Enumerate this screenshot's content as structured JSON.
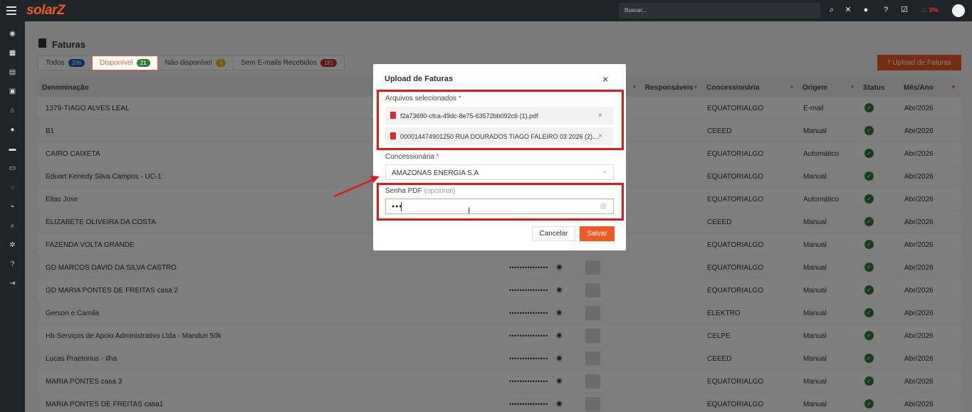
{
  "app": {
    "logo": "solarZ",
    "search_placeholder": "Buscar...",
    "pct": "0%"
  },
  "page": {
    "title": "Faturas"
  },
  "tabs": [
    {
      "label": "Todos",
      "count": "206",
      "color": "#1e5bb8"
    },
    {
      "label": "Disponível",
      "count": "21",
      "color": "#2e7d32"
    },
    {
      "label": "Não disponível",
      "count": "4",
      "color": "#f0b400"
    },
    {
      "label": "Sem E-mails Recebidos",
      "count": "181",
      "color": "#c62828"
    }
  ],
  "upload_button": "⤒  Upload de Faturas",
  "table": {
    "headers": {
      "denominacao": "Denominação",
      "responsaveis": "Responsáveis",
      "concessionaria": "Concessionária",
      "origem": "Origem",
      "status": "Status",
      "mes_ano": "Mês/Ano"
    },
    "rows": [
      {
        "name": "1379-TIAGO ALVES LEAL",
        "conc": "EQUATORIALGO",
        "origem": "E-mail",
        "mes": "Abr/2026",
        "pw": false
      },
      {
        "name": "B1",
        "conc": "CEEED",
        "origem": "Manual",
        "mes": "Abr/2026",
        "pw": false
      },
      {
        "name": "CAIRO CAIXETA",
        "conc": "EQUATORIALGO",
        "origem": "Automático",
        "mes": "Abr/2026",
        "pw": false
      },
      {
        "name": "Eduart Kenedy Silva Campos - UC-1",
        "conc": "EQUATORIALGO",
        "origem": "Manual",
        "mes": "Abr/2026",
        "pw": false
      },
      {
        "name": "Elias Jose",
        "conc": "EQUATORIALGO",
        "origem": "Automático",
        "mes": "Abr/2026",
        "pw": false
      },
      {
        "name": "ELIZABETE OLIVEIRA DA COSTA",
        "conc": "CEEED",
        "origem": "Manual",
        "mes": "Abr/2026",
        "pw": false
      },
      {
        "name": "FAZENDA VOLTA GRANDE",
        "conc": "EQUATORIALGO",
        "origem": "Manual",
        "mes": "Abr/2026",
        "pw": false
      },
      {
        "name": "GD MARCOS DAVID DA SILVA CASTRO",
        "conc": "EQUATORIALGO",
        "origem": "Manual",
        "mes": "Abr/2026",
        "pw": true
      },
      {
        "name": "GD MARIA PONTES DE FREITAS casa 2",
        "conc": "EQUATORIALGO",
        "origem": "Manual",
        "mes": "Abr/2026",
        "pw": true
      },
      {
        "name": "Gerson e Camila",
        "conc": "ELEKTRO",
        "origem": "Manual",
        "mes": "Abr/2026",
        "pw": true
      },
      {
        "name": "Hb Serviços de Apoio Administrativo Ltda - Manduri 50k",
        "conc": "CELPE",
        "origem": "Manual",
        "mes": "Abr/2026",
        "pw": true
      },
      {
        "name": "Lucas Praetorius - Ilha",
        "conc": "CEEED",
        "origem": "Manual",
        "mes": "Abr/2026",
        "pw": true
      },
      {
        "name": "MARIA PONTES casa 3",
        "conc": "EQUATORIALGO",
        "origem": "Manual",
        "mes": "Abr/2026",
        "pw": true
      },
      {
        "name": "MARIA PONTES DE FREITAS casa1",
        "conc": "EQUATORIALGO",
        "origem": "Manual",
        "mes": "Abr/2026",
        "pw": true
      }
    ],
    "password_mask": "•••••••••••••••"
  },
  "modal": {
    "title": "Upload de Faturas",
    "close": "×",
    "files_label": "Arquivos selecionados",
    "required_mark": "*",
    "files": [
      "f2a73690-cfca-49dc-8e75-63572bb092c6 (1).pdf",
      "000014474901250 RUA DOURADOS TIAGO FALEIRO 03 2026 (2)...."
    ],
    "remove": "×",
    "conc_label": "Concessionária",
    "conc_value": "AMAZONAS ENERGIA S.A",
    "pwd_label": "Senha PDF",
    "pwd_optional": "(opcional)",
    "pwd_value": "•••",
    "cancel": "Cancelar",
    "save": "Salvar"
  },
  "colors": {
    "accent": "#f05a22",
    "highlight": "#e01818",
    "ok": "#2e7d32"
  }
}
